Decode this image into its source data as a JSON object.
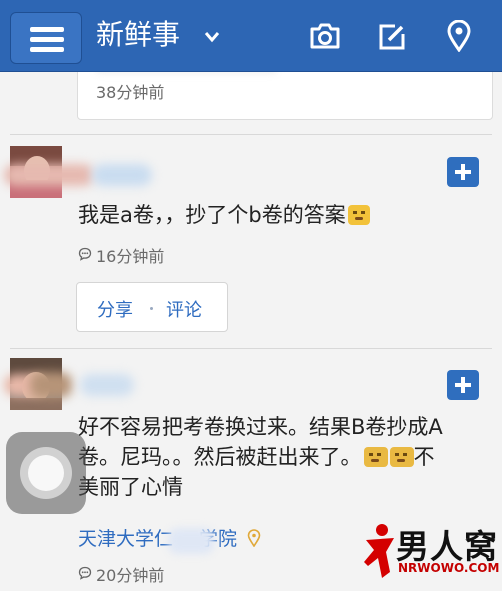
{
  "header": {
    "title": "新鲜事",
    "icons": [
      "menu-icon",
      "chevron-down-icon",
      "camera-icon",
      "edit-icon",
      "location-pin-icon"
    ]
  },
  "feed": {
    "previous_post": {
      "time": "38分钟前"
    },
    "posts": [
      {
        "text": "我是a卷，，抄了个b卷的答案",
        "time": "16分钟前",
        "actions": {
          "share": "分享",
          "comment": "评论"
        }
      },
      {
        "text_line1": "好不容易把考卷换过来。结果B卷抄成A",
        "text_line2": "卷。尼玛。。然后被赶出来了。",
        "text_line2_end": "不",
        "text_line3": "美丽了心情",
        "location_start": "天津大学仁",
        "location_end": "学院",
        "time": "20分钟前"
      }
    ]
  },
  "watermark": {
    "brand": "男人窝",
    "url": "NRWOWO.COM"
  },
  "colors": {
    "header": "#2d66b4",
    "accent": "#2f6cc0",
    "plus": "#2f6ebe"
  }
}
